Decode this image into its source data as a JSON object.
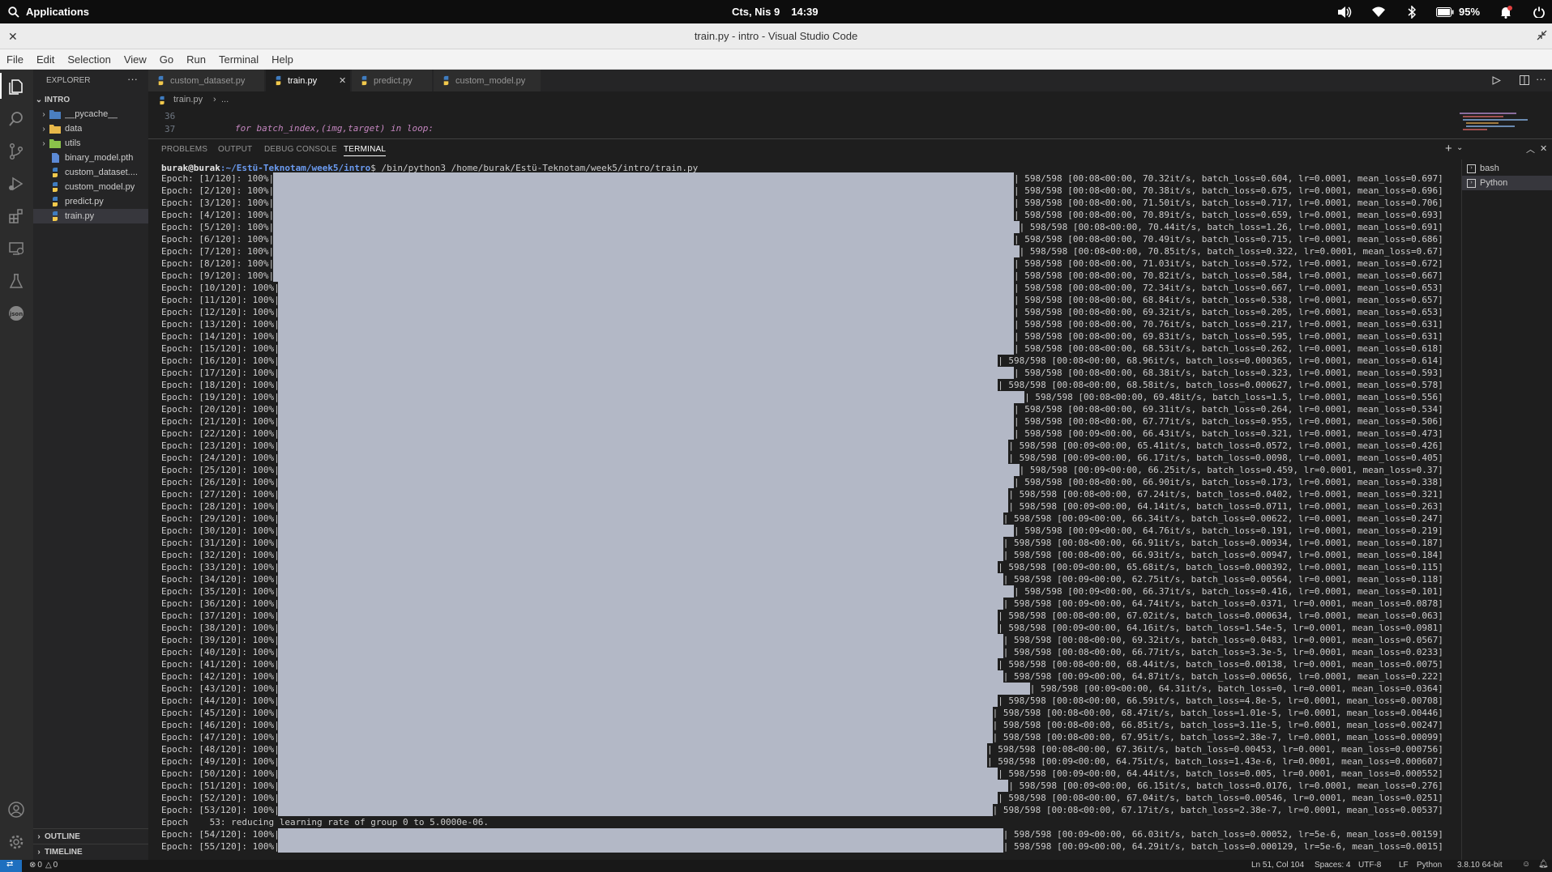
{
  "topbar": {
    "applications": "Applications",
    "date": "Cts, Nis 9",
    "time": "14:39",
    "battery": "95%"
  },
  "window": {
    "title": "train.py - intro - Visual Studio Code"
  },
  "menu": [
    "File",
    "Edit",
    "Selection",
    "View",
    "Go",
    "Run",
    "Terminal",
    "Help"
  ],
  "sidebar": {
    "title": "EXPLORER",
    "folder": "INTRO",
    "items": [
      {
        "label": "__pycache__",
        "kind": "folder"
      },
      {
        "label": "data",
        "kind": "folder"
      },
      {
        "label": "utils",
        "kind": "folder"
      },
      {
        "label": "binary_model.pth",
        "kind": "file"
      },
      {
        "label": "custom_dataset....",
        "kind": "py"
      },
      {
        "label": "custom_model.py",
        "kind": "py"
      },
      {
        "label": "predict.py",
        "kind": "py"
      },
      {
        "label": "train.py",
        "kind": "py"
      }
    ],
    "outline": "OUTLINE",
    "timeline": "TIMELINE"
  },
  "tabs": [
    {
      "label": "custom_dataset.py"
    },
    {
      "label": "train.py"
    },
    {
      "label": "predict.py"
    },
    {
      "label": "custom_model.py"
    }
  ],
  "breadcrumb": {
    "file": "train.py",
    "rest": "..."
  },
  "code": {
    "line1_no": "36",
    "line2_no": "37",
    "line2_text": "for batch_index,(img,target) in loop:"
  },
  "panel": {
    "tabs": [
      "PROBLEMS",
      "OUTPUT",
      "DEBUG CONSOLE",
      "TERMINAL"
    ],
    "terminals": [
      "bash",
      "Python"
    ]
  },
  "terminal": {
    "prompt_user": "burak@burak",
    "prompt_path": ":~/Estü-Teknotam/week5/intro",
    "prompt_cmd": "$ /bin/python3 /home/burak/Estü-Teknotam/week5/intro/train.py",
    "lines": [
      {
        "prefix": "Epoch: [1/120]: 100%|",
        "stats": "| 598/598 [00:08<00:00, 70.32it/s, batch_loss=0.604, lr=0.0001, mean_loss=0.697]"
      },
      {
        "prefix": "Epoch: [2/120]: 100%|",
        "stats": "| 598/598 [00:08<00:00, 70.38it/s, batch_loss=0.675, lr=0.0001, mean_loss=0.696]"
      },
      {
        "prefix": "Epoch: [3/120]: 100%|",
        "stats": "| 598/598 [00:08<00:00, 71.50it/s, batch_loss=0.717, lr=0.0001, mean_loss=0.706]"
      },
      {
        "prefix": "Epoch: [4/120]: 100%|",
        "stats": "| 598/598 [00:08<00:00, 70.89it/s, batch_loss=0.659, lr=0.0001, mean_loss=0.693]"
      },
      {
        "prefix": "Epoch: [5/120]: 100%|",
        "stats": "| 598/598 [00:08<00:00, 70.44it/s, batch_loss=1.26, lr=0.0001, mean_loss=0.691]"
      },
      {
        "prefix": "Epoch: [6/120]: 100%|",
        "stats": "| 598/598 [00:08<00:00, 70.49it/s, batch_loss=0.715, lr=0.0001, mean_loss=0.686]"
      },
      {
        "prefix": "Epoch: [7/120]: 100%|",
        "stats": "| 598/598 [00:08<00:00, 70.85it/s, batch_loss=0.322, lr=0.0001, mean_loss=0.67]"
      },
      {
        "prefix": "Epoch: [8/120]: 100%|",
        "stats": "| 598/598 [00:08<00:00, 71.03it/s, batch_loss=0.572, lr=0.0001, mean_loss=0.672]"
      },
      {
        "prefix": "Epoch: [9/120]: 100%|",
        "stats": "| 598/598 [00:08<00:00, 70.82it/s, batch_loss=0.584, lr=0.0001, mean_loss=0.667]"
      },
      {
        "prefix": "Epoch: [10/120]: 100%|",
        "stats": "| 598/598 [00:08<00:00, 72.34it/s, batch_loss=0.667, lr=0.0001, mean_loss=0.653]"
      },
      {
        "prefix": "Epoch: [11/120]: 100%|",
        "stats": "| 598/598 [00:08<00:00, 68.84it/s, batch_loss=0.538, lr=0.0001, mean_loss=0.657]"
      },
      {
        "prefix": "Epoch: [12/120]: 100%|",
        "stats": "| 598/598 [00:08<00:00, 69.32it/s, batch_loss=0.205, lr=0.0001, mean_loss=0.653]"
      },
      {
        "prefix": "Epoch: [13/120]: 100%|",
        "stats": "| 598/598 [00:08<00:00, 70.76it/s, batch_loss=0.217, lr=0.0001, mean_loss=0.631]"
      },
      {
        "prefix": "Epoch: [14/120]: 100%|",
        "stats": "| 598/598 [00:08<00:00, 69.83it/s, batch_loss=0.595, lr=0.0001, mean_loss=0.631]"
      },
      {
        "prefix": "Epoch: [15/120]: 100%|",
        "stats": "| 598/598 [00:08<00:00, 68.53it/s, batch_loss=0.262, lr=0.0001, mean_loss=0.618]"
      },
      {
        "prefix": "Epoch: [16/120]: 100%|",
        "stats": "| 598/598 [00:08<00:00, 68.96it/s, batch_loss=0.000365, lr=0.0001, mean_loss=0.614]"
      },
      {
        "prefix": "Epoch: [17/120]: 100%|",
        "stats": "| 598/598 [00:08<00:00, 68.38it/s, batch_loss=0.323, lr=0.0001, mean_loss=0.593]"
      },
      {
        "prefix": "Epoch: [18/120]: 100%|",
        "stats": "| 598/598 [00:08<00:00, 68.58it/s, batch_loss=0.000627, lr=0.0001, mean_loss=0.578]"
      },
      {
        "prefix": "Epoch: [19/120]: 100%|",
        "stats": "| 598/598 [00:08<00:00, 69.48it/s, batch_loss=1.5, lr=0.0001, mean_loss=0.556]"
      },
      {
        "prefix": "Epoch: [20/120]: 100%|",
        "stats": "| 598/598 [00:08<00:00, 69.31it/s, batch_loss=0.264, lr=0.0001, mean_loss=0.534]"
      },
      {
        "prefix": "Epoch: [21/120]: 100%|",
        "stats": "| 598/598 [00:08<00:00, 67.77it/s, batch_loss=0.955, lr=0.0001, mean_loss=0.506]"
      },
      {
        "prefix": "Epoch: [22/120]: 100%|",
        "stats": "| 598/598 [00:09<00:00, 66.43it/s, batch_loss=0.321, lr=0.0001, mean_loss=0.473]"
      },
      {
        "prefix": "Epoch: [23/120]: 100%|",
        "stats": "| 598/598 [00:09<00:00, 65.41it/s, batch_loss=0.0572, lr=0.0001, mean_loss=0.426]"
      },
      {
        "prefix": "Epoch: [24/120]: 100%|",
        "stats": "| 598/598 [00:09<00:00, 66.17it/s, batch_loss=0.0098, lr=0.0001, mean_loss=0.405]"
      },
      {
        "prefix": "Epoch: [25/120]: 100%|",
        "stats": "| 598/598 [00:09<00:00, 66.25it/s, batch_loss=0.459, lr=0.0001, mean_loss=0.37]"
      },
      {
        "prefix": "Epoch: [26/120]: 100%|",
        "stats": "| 598/598 [00:08<00:00, 66.90it/s, batch_loss=0.173, lr=0.0001, mean_loss=0.338]"
      },
      {
        "prefix": "Epoch: [27/120]: 100%|",
        "stats": "| 598/598 [00:08<00:00, 67.24it/s, batch_loss=0.0402, lr=0.0001, mean_loss=0.321]"
      },
      {
        "prefix": "Epoch: [28/120]: 100%|",
        "stats": "| 598/598 [00:09<00:00, 64.14it/s, batch_loss=0.0711, lr=0.0001, mean_loss=0.263]"
      },
      {
        "prefix": "Epoch: [29/120]: 100%|",
        "stats": "| 598/598 [00:09<00:00, 66.34it/s, batch_loss=0.00622, lr=0.0001, mean_loss=0.247]"
      },
      {
        "prefix": "Epoch: [30/120]: 100%|",
        "stats": "| 598/598 [00:09<00:00, 64.76it/s, batch_loss=0.191, lr=0.0001, mean_loss=0.219]"
      },
      {
        "prefix": "Epoch: [31/120]: 100%|",
        "stats": "| 598/598 [00:08<00:00, 66.91it/s, batch_loss=0.00934, lr=0.0001, mean_loss=0.187]"
      },
      {
        "prefix": "Epoch: [32/120]: 100%|",
        "stats": "| 598/598 [00:08<00:00, 66.93it/s, batch_loss=0.00947, lr=0.0001, mean_loss=0.184]"
      },
      {
        "prefix": "Epoch: [33/120]: 100%|",
        "stats": "| 598/598 [00:09<00:00, 65.68it/s, batch_loss=0.000392, lr=0.0001, mean_loss=0.115]"
      },
      {
        "prefix": "Epoch: [34/120]: 100%|",
        "stats": "| 598/598 [00:09<00:00, 62.75it/s, batch_loss=0.00564, lr=0.0001, mean_loss=0.118]"
      },
      {
        "prefix": "Epoch: [35/120]: 100%|",
        "stats": "| 598/598 [00:09<00:00, 66.37it/s, batch_loss=0.416, lr=0.0001, mean_loss=0.101]"
      },
      {
        "prefix": "Epoch: [36/120]: 100%|",
        "stats": "| 598/598 [00:09<00:00, 64.74it/s, batch_loss=0.0371, lr=0.0001, mean_loss=0.0878]"
      },
      {
        "prefix": "Epoch: [37/120]: 100%|",
        "stats": "| 598/598 [00:08<00:00, 67.02it/s, batch_loss=0.000634, lr=0.0001, mean_loss=0.063]"
      },
      {
        "prefix": "Epoch: [38/120]: 100%|",
        "stats": "| 598/598 [00:09<00:00, 64.16it/s, batch_loss=1.54e-5, lr=0.0001, mean_loss=0.0981]"
      },
      {
        "prefix": "Epoch: [39/120]: 100%|",
        "stats": "| 598/598 [00:08<00:00, 69.32it/s, batch_loss=0.0483, lr=0.0001, mean_loss=0.0567]"
      },
      {
        "prefix": "Epoch: [40/120]: 100%|",
        "stats": "| 598/598 [00:08<00:00, 66.77it/s, batch_loss=3.3e-5, lr=0.0001, mean_loss=0.0233]"
      },
      {
        "prefix": "Epoch: [41/120]: 100%|",
        "stats": "| 598/598 [00:08<00:00, 68.44it/s, batch_loss=0.00138, lr=0.0001, mean_loss=0.0075]"
      },
      {
        "prefix": "Epoch: [42/120]: 100%|",
        "stats": "| 598/598 [00:09<00:00, 64.87it/s, batch_loss=0.00656, lr=0.0001, mean_loss=0.222]"
      },
      {
        "prefix": "Epoch: [43/120]: 100%|",
        "stats": "| 598/598 [00:09<00:00, 64.31it/s, batch_loss=0, lr=0.0001, mean_loss=0.0364]"
      },
      {
        "prefix": "Epoch: [44/120]: 100%|",
        "stats": "| 598/598 [00:08<00:00, 66.59it/s, batch_loss=4.8e-5, lr=0.0001, mean_loss=0.00708]"
      },
      {
        "prefix": "Epoch: [45/120]: 100%|",
        "stats": "| 598/598 [00:08<00:00, 68.47it/s, batch_loss=1.01e-5, lr=0.0001, mean_loss=0.00446]"
      },
      {
        "prefix": "Epoch: [46/120]: 100%|",
        "stats": "| 598/598 [00:08<00:00, 66.85it/s, batch_loss=3.11e-5, lr=0.0001, mean_loss=0.00247]"
      },
      {
        "prefix": "Epoch: [47/120]: 100%|",
        "stats": "| 598/598 [00:08<00:00, 67.95it/s, batch_loss=2.38e-7, lr=0.0001, mean_loss=0.00099]"
      },
      {
        "prefix": "Epoch: [48/120]: 100%|",
        "stats": "| 598/598 [00:08<00:00, 67.36it/s, batch_loss=0.00453, lr=0.0001, mean_loss=0.000756]"
      },
      {
        "prefix": "Epoch: [49/120]: 100%|",
        "stats": "| 598/598 [00:09<00:00, 64.75it/s, batch_loss=1.43e-6, lr=0.0001, mean_loss=0.000607]"
      },
      {
        "prefix": "Epoch: [50/120]: 100%|",
        "stats": "| 598/598 [00:09<00:00, 64.44it/s, batch_loss=0.005, lr=0.0001, mean_loss=0.000552]"
      },
      {
        "prefix": "Epoch: [51/120]: 100%|",
        "stats": "| 598/598 [00:09<00:00, 66.15it/s, batch_loss=0.0176, lr=0.0001, mean_loss=0.276]"
      },
      {
        "prefix": "Epoch: [52/120]: 100%|",
        "stats": "| 598/598 [00:08<00:00, 67.04it/s, batch_loss=0.00546, lr=0.0001, mean_loss=0.0251]"
      },
      {
        "prefix": "Epoch: [53/120]: 100%|",
        "stats": "| 598/598 [00:08<00:00, 67.17it/s, batch_loss=2.38e-7, lr=0.0001, mean_loss=0.00537]"
      },
      {
        "prefix": "Epoch    53: reducing learning rate of group 0 to 5.0000e-06.",
        "stats": ""
      },
      {
        "prefix": "Epoch: [54/120]: 100%|",
        "stats": "| 598/598 [00:09<00:00, 66.03it/s, batch_loss=0.00052, lr=5e-6, mean_loss=0.00159]"
      },
      {
        "prefix": "Epoch: [55/120]: 100%|",
        "stats": "| 598/598 [00:09<00:00, 64.29it/s, batch_loss=0.000129, lr=5e-6, mean_loss=0.0015]"
      }
    ]
  },
  "statusbar": {
    "problems": "0",
    "warnings": "0",
    "position": "Ln 51, Col 104",
    "spaces": "Spaces: 4",
    "encoding": "UTF-8",
    "eol": "LF",
    "language": "Python",
    "interpreter": "3.8.10 64-bit"
  }
}
